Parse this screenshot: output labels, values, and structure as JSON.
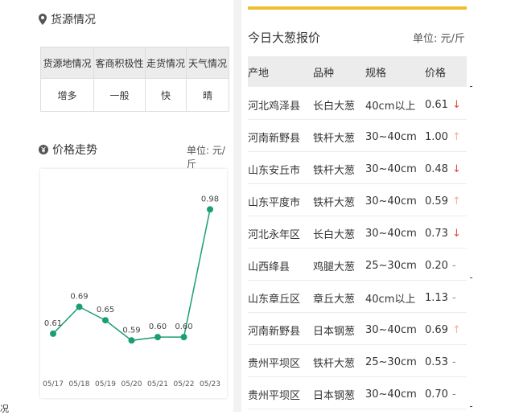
{
  "colors": {
    "accent": "#f0bd2e",
    "line": "#1a9e76",
    "down": "#e04a3a",
    "up": "#f2b38c",
    "flat": "#888888"
  },
  "supply": {
    "title": "货源情况",
    "icon": "location-pin-icon",
    "headers": [
      "货源地情况",
      "客商积极性",
      "走货情况",
      "天气情况"
    ],
    "values": [
      "增多",
      "一般",
      "快",
      "晴"
    ]
  },
  "trend": {
    "title": "价格走势",
    "icon": "yen-coin-icon",
    "unit": "单位: 元/斤"
  },
  "chart_data": {
    "type": "line",
    "categories": [
      "05/17",
      "05/18",
      "05/19",
      "05/20",
      "05/21",
      "05/22",
      "05/23"
    ],
    "values": [
      0.61,
      0.69,
      0.65,
      0.59,
      0.6,
      0.6,
      0.98
    ],
    "labels": [
      "0.61",
      "0.69",
      "0.65",
      "0.59",
      "0.60",
      "0.60",
      "0.98"
    ],
    "title": "",
    "xlabel": "",
    "ylabel": "",
    "ylim": [
      0.55,
      1.0
    ],
    "grid": false
  },
  "stray_text": "况",
  "prices": {
    "title": "今日大葱报价",
    "unit": "单位: 元/斤",
    "headers": [
      "产地",
      "品种",
      "规格",
      "价格"
    ],
    "rows": [
      {
        "origin": "河北鸡泽县",
        "variety": "长白大葱",
        "spec": "40cm以上",
        "price": "0.61",
        "trend": "↓",
        "trend_kind": "down"
      },
      {
        "origin": "河南新野县",
        "variety": "铁杆大葱",
        "spec": "30~40cm",
        "price": "1.00",
        "trend": "↑",
        "trend_kind": "up"
      },
      {
        "origin": "山东安丘市",
        "variety": "铁杆大葱",
        "spec": "30~40cm",
        "price": "0.48",
        "trend": "↓",
        "trend_kind": "down"
      },
      {
        "origin": "山东平度市",
        "variety": "铁杆大葱",
        "spec": "30~40cm",
        "price": "0.59",
        "trend": "↑",
        "trend_kind": "up"
      },
      {
        "origin": "河北永年区",
        "variety": "长白大葱",
        "spec": "30~40cm",
        "price": "0.73",
        "trend": "↓",
        "trend_kind": "down"
      },
      {
        "origin": "山西绛县",
        "variety": "鸡腿大葱",
        "spec": "25~30cm",
        "price": "0.20",
        "trend": "-",
        "trend_kind": "flat"
      },
      {
        "origin": "山东章丘区",
        "variety": "章丘大葱",
        "spec": "40cm以上",
        "price": "1.13",
        "trend": "-",
        "trend_kind": "flat"
      },
      {
        "origin": "河南新野县",
        "variety": "日本钢葱",
        "spec": "30~40cm",
        "price": "0.69",
        "trend": "↑",
        "trend_kind": "up"
      },
      {
        "origin": "贵州平坝区",
        "variety": "铁杆大葱",
        "spec": "25~30cm",
        "price": "0.53",
        "trend": "-",
        "trend_kind": "flat"
      },
      {
        "origin": "贵州平坝区",
        "variety": "日本钢葱",
        "spec": "30~40cm",
        "price": "0.70",
        "trend": "-",
        "trend_kind": "flat"
      }
    ]
  }
}
